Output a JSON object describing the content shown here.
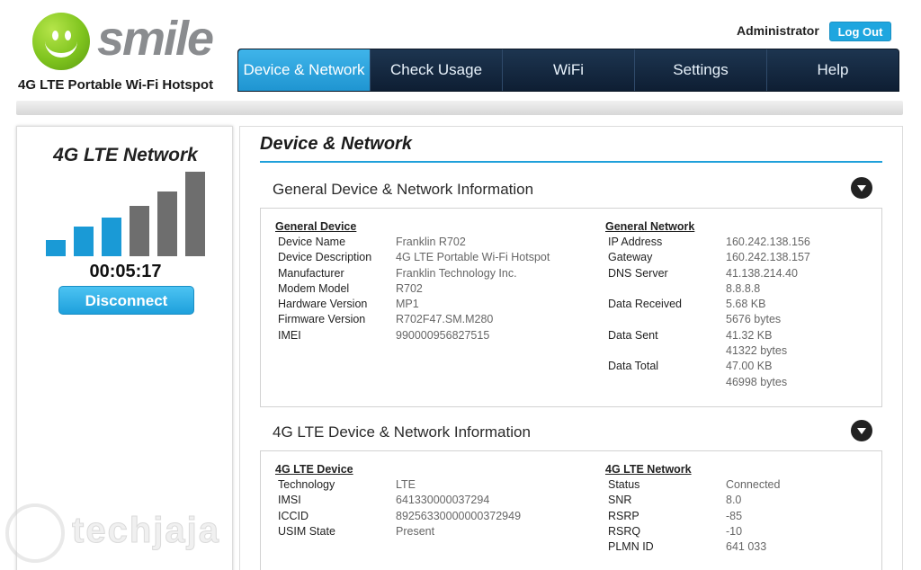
{
  "brand": {
    "name": "smile",
    "tagline": "4G LTE Portable Wi-Fi Hotspot",
    "accent": "#1fa6df",
    "logo_green": "#7fc41e"
  },
  "header": {
    "user": "Administrator",
    "logout_label": "Log Out"
  },
  "nav": {
    "tabs": [
      {
        "label": "Device & Network",
        "active": true
      },
      {
        "label": "Check Usage",
        "active": false
      },
      {
        "label": "WiFi",
        "active": false
      },
      {
        "label": "Settings",
        "active": false
      },
      {
        "label": "Help",
        "active": false
      }
    ]
  },
  "sidebar": {
    "title": "4G LTE Network",
    "signal": {
      "bars_total": 6,
      "bars_active": 3,
      "active_color": "#1a9ad6",
      "inactive_color": "#6e6e6e"
    },
    "timer": "00:05:17",
    "disconnect_label": "Disconnect"
  },
  "main": {
    "title": "Device & Network",
    "sections": [
      {
        "heading": "General Device & Network Information",
        "left": {
          "header": "General Device",
          "rows": [
            {
              "k": "Device Name",
              "v": [
                "Franklin R702"
              ]
            },
            {
              "k": "Device Description",
              "v": [
                "4G LTE Portable Wi-Fi Hotspot"
              ]
            },
            {
              "k": "Manufacturer",
              "v": [
                "Franklin Technology Inc."
              ]
            },
            {
              "k": "Modem Model",
              "v": [
                "R702"
              ]
            },
            {
              "k": "Hardware Version",
              "v": [
                "MP1"
              ]
            },
            {
              "k": "Firmware Version",
              "v": [
                "R702F47.SM.M280"
              ]
            },
            {
              "k": "IMEI",
              "v": [
                "990000956827515"
              ]
            }
          ]
        },
        "right": {
          "header": "General Network",
          "rows": [
            {
              "k": "IP Address",
              "v": [
                "160.242.138.156"
              ]
            },
            {
              "k": "Gateway",
              "v": [
                "160.242.138.157"
              ]
            },
            {
              "k": "DNS Server",
              "v": [
                "41.138.214.40",
                "8.8.8.8"
              ]
            },
            {
              "k": "Data Received",
              "v": [
                "5.68 KB",
                "5676 bytes"
              ]
            },
            {
              "k": "Data Sent",
              "v": [
                "41.32 KB",
                "41322 bytes"
              ]
            },
            {
              "k": "Data Total",
              "v": [
                "47.00 KB",
                "46998 bytes"
              ]
            }
          ]
        }
      },
      {
        "heading": "4G LTE Device & Network Information",
        "left": {
          "header": "4G LTE Device",
          "rows": [
            {
              "k": "Technology",
              "v": [
                "LTE"
              ]
            },
            {
              "k": "IMSI",
              "v": [
                "641330000037294"
              ]
            },
            {
              "k": "ICCID",
              "v": [
                "89256330000000372949"
              ]
            },
            {
              "k": "USIM State",
              "v": [
                "Present"
              ]
            }
          ]
        },
        "right": {
          "header": "4G LTE Network",
          "rows": [
            {
              "k": "Status",
              "v": [
                "Connected"
              ]
            },
            {
              "k": "SNR",
              "v": [
                "8.0"
              ]
            },
            {
              "k": "RSRP",
              "v": [
                "-85"
              ]
            },
            {
              "k": "RSRQ",
              "v": [
                "-10"
              ]
            },
            {
              "k": "PLMN ID",
              "v": [
                "641 033"
              ]
            }
          ]
        }
      }
    ]
  }
}
